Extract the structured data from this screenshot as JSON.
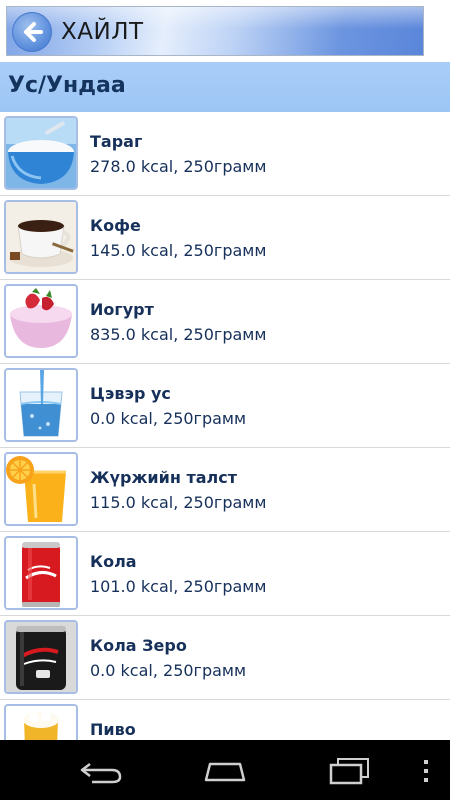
{
  "search": {
    "label": "ХАЙЛТ",
    "back_icon": "back-arrow-icon"
  },
  "category": {
    "title": "Ус/Ундаа"
  },
  "items": [
    {
      "name": "Тараг",
      "info": "278.0 kcal, 250грамм",
      "image": "yogurt-bowl-icon"
    },
    {
      "name": "Кофе",
      "info": "145.0 kcal, 250грамм",
      "image": "coffee-cup-icon"
    },
    {
      "name": "Иогурт",
      "info": "835.0 kcal, 250грамм",
      "image": "strawberry-yogurt-icon"
    },
    {
      "name": "Цэвэр ус",
      "info": "0.0 kcal, 250грамм",
      "image": "water-glass-icon"
    },
    {
      "name": "Жүржийн талст",
      "info": "115.0 kcal, 250грамм",
      "image": "orange-juice-icon"
    },
    {
      "name": "Кола",
      "info": "101.0 kcal, 250грамм",
      "image": "cola-can-icon"
    },
    {
      "name": "Кола Зеро",
      "info": "0.0 kcal, 250грамм",
      "image": "cola-zero-can-icon"
    },
    {
      "name": "Пиво",
      "info": "",
      "image": "beer-glass-icon"
    }
  ],
  "nav": {
    "back": "nav-back-icon",
    "home": "nav-home-icon",
    "recents": "nav-recents-icon",
    "menu": "nav-menu-icon"
  },
  "colors": {
    "header_bg": "#a9cdf8",
    "text": "#16305a",
    "thumb_border": "#a6bde4"
  }
}
